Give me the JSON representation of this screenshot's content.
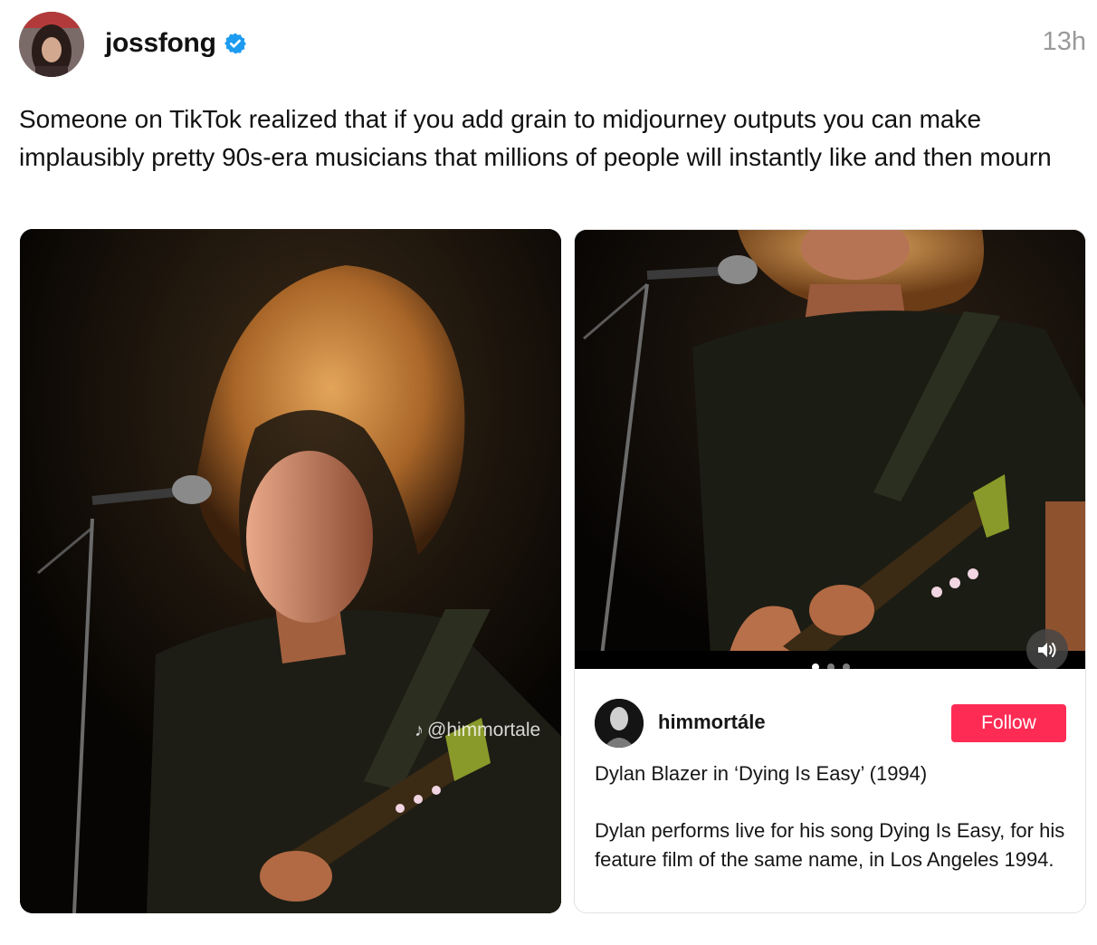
{
  "post": {
    "username": "jossfong",
    "verified": true,
    "timestamp": "13h",
    "text": "Someone on TikTok realized that if you add grain to midjourney outputs you can make implausibly pretty 90s-era musicians that millions of people will instantly like and then mourn"
  },
  "media_left": {
    "watermark_handle": "@himmortale",
    "watermark_icon": "tiktok-icon"
  },
  "tiktok_card": {
    "username": "himmortále",
    "follow_label": "Follow",
    "title": "Dylan Blazer in ‘Dying Is Easy’ (1994)",
    "description": "Dylan performs live for his song Dying Is Easy, for his feature film of the same name, in Los Angeles 1994.",
    "carousel_dots": 3,
    "active_dot": 1
  },
  "colors": {
    "verified_blue": "#1d9bf0",
    "follow_red": "#fe2c55",
    "timestamp_gray": "#9a9a9a"
  }
}
